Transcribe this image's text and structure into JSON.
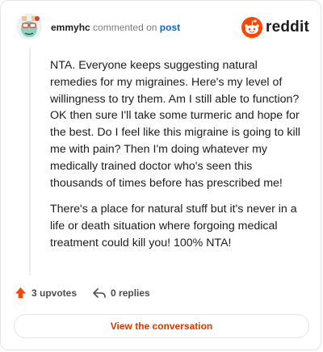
{
  "header": {
    "username": "emmyhc",
    "action": "commented on",
    "post_link": "post",
    "brand": "reddit"
  },
  "comment": {
    "paragraphs": [
      "NTA. Everyone keeps suggesting natural remedies for my migraines. Here's my level of willingness to try them. Am I still able to function? OK then sure I'll take some turmeric and hope for the best. Do I feel like this migraine is going to kill me with pain? Then I'm doing whatever my medically trained doctor who's seen this thousands of times before has prescribed me!",
      "There's a place for natural stuff but it's never in a life or death situation where forgoing medical treatment could kill you! 100% NTA!"
    ]
  },
  "stats": {
    "upvotes": "3 upvotes",
    "replies": "0 replies"
  },
  "cta": {
    "label": "View the conversation"
  },
  "icons": {
    "upvote": "upvote-arrow-icon",
    "reply": "reply-arrow-icon",
    "logo": "reddit-snoo-icon",
    "avatar": "user-avatar"
  },
  "colors": {
    "accent": "#d93900",
    "upvote": "#ff4500",
    "link": "#0a66d6",
    "muted": "#7c7c7c"
  }
}
